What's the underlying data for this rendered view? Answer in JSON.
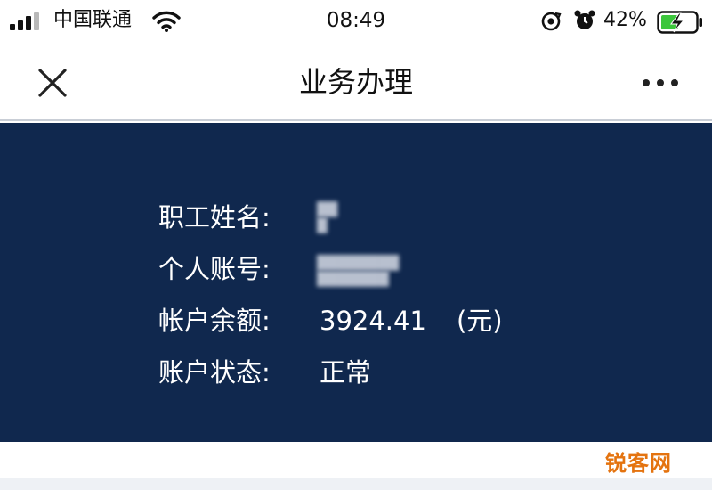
{
  "status_bar": {
    "carrier": "中国联通",
    "time": "08:49",
    "battery": "42%"
  },
  "nav": {
    "title": "业务办理"
  },
  "account": {
    "fields": [
      {
        "label": "职工姓名:",
        "value_lines": [
          "██",
          "█"
        ]
      },
      {
        "label": "个人账号:",
        "value_lines": [
          "████████",
          "███████"
        ]
      },
      {
        "label": "帐户余额:",
        "value": "3924.41",
        "unit": "(元)"
      },
      {
        "label": "账户状态:",
        "value": "正常"
      }
    ]
  },
  "watermark": "锐客网",
  "colors": {
    "card_background": "#10284e",
    "battery_charging": "#3cc63c",
    "watermark": "#e4730f"
  },
  "icons": {
    "status": [
      "signal-bars-icon",
      "wifi-icon",
      "screen-rotation-lock-icon",
      "alarm-clock-icon",
      "battery-charging-icon"
    ],
    "nav": [
      "close-icon",
      "more-dots-icon"
    ]
  }
}
